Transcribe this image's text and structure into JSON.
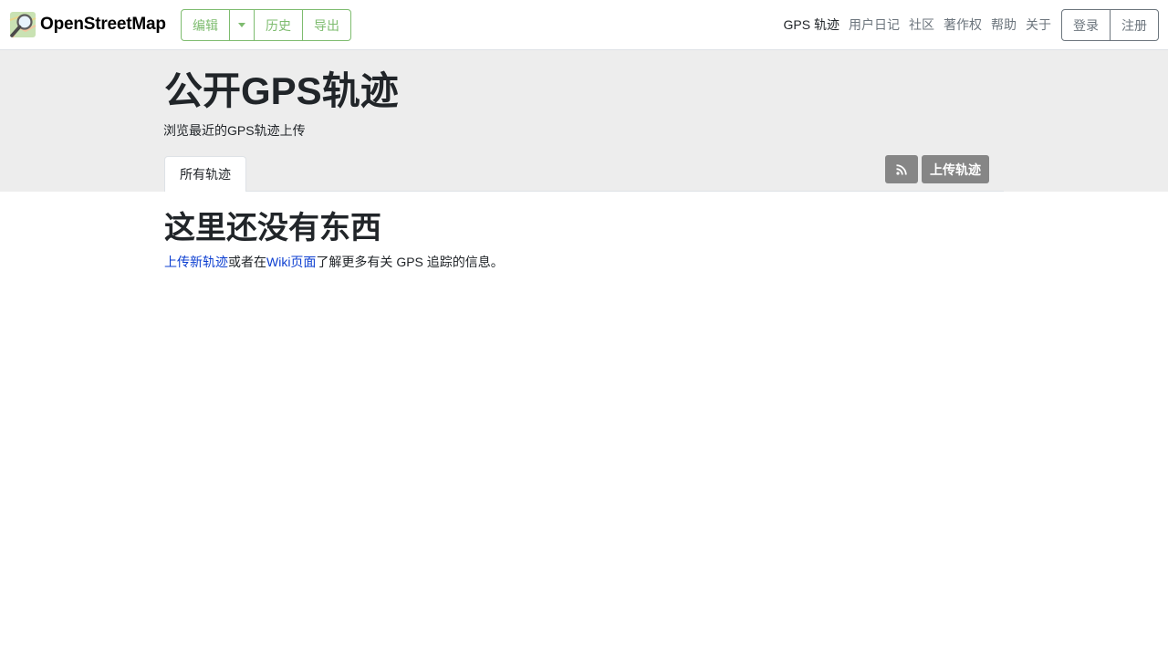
{
  "header": {
    "brand_name": "OpenStreetMap",
    "primary_buttons": {
      "edit": "编辑",
      "history": "历史",
      "export": "导出"
    },
    "nav": [
      {
        "label": "GPS 轨迹",
        "active": true
      },
      {
        "label": "用户日记"
      },
      {
        "label": "社区"
      },
      {
        "label": "著作权"
      },
      {
        "label": "帮助"
      },
      {
        "label": "关于"
      }
    ],
    "login_label": "登录",
    "signup_label": "注册"
  },
  "content_heading": {
    "title": "公开GPS轨迹",
    "subtitle": "浏览最近的GPS轨迹上传",
    "tab_all": "所有轨迹",
    "upload_button": "上传轨迹",
    "rss_icon": "rss-icon"
  },
  "main": {
    "empty_title": "这里还没有东西",
    "upload_link": "上传新轨迹",
    "text_or": "或者在",
    "wiki_link": "Wiki页面",
    "text_after": "了解更多有关 GPS 追踪的信息。"
  },
  "colors": {
    "accent_green": "#7ebc6f",
    "heading_band": "#ededed",
    "action_button": "#868686",
    "link": "#0d3fd1"
  }
}
